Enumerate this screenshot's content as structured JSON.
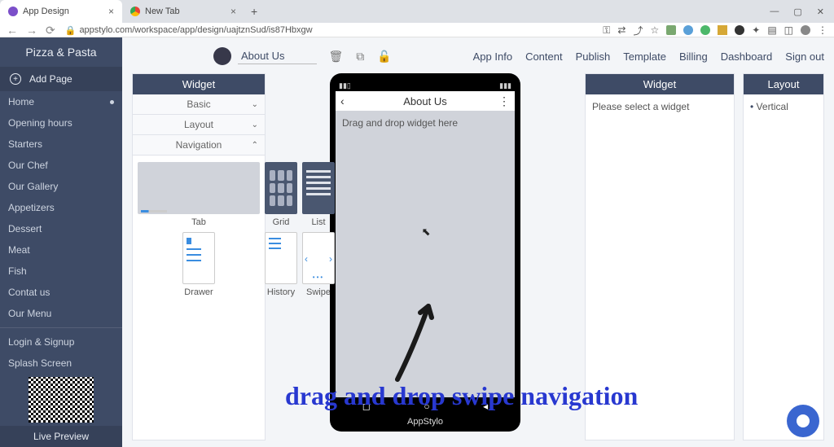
{
  "browser": {
    "tab1": "App Design",
    "tab2": "New Tab",
    "url": "appstylo.com/workspace/app/design/uajtznSud/is87Hbxgw"
  },
  "sidebar": {
    "brand": "Pizza & Pasta",
    "add_page": "Add Page",
    "items": [
      "Home",
      "Opening hours",
      "Starters",
      "Our Chef",
      "Our Gallery",
      "Appetizers",
      "Dessert",
      "Meat",
      "Fish",
      "Contat us",
      "Our Menu"
    ],
    "items2": [
      "Login & Signup",
      "Splash Screen"
    ],
    "live": "Live Preview"
  },
  "topbar": {
    "page_title": "About Us",
    "nav": [
      "App Info",
      "Content",
      "Publish",
      "Template",
      "Billing",
      "Dashboard",
      "Sign out"
    ]
  },
  "left_panel": {
    "header": "Widget",
    "sections": {
      "basic": "Basic",
      "layout": "Layout",
      "navigation": "Navigation"
    },
    "widgets": [
      "Tab",
      "Grid",
      "List",
      "Drawer",
      "History",
      "Swipe"
    ]
  },
  "phone": {
    "title": "About Us",
    "placeholder": "Drag and drop widget here",
    "brand": "AppStylo"
  },
  "right_panel": {
    "header": "Widget",
    "msg": "Please select a widget"
  },
  "layout_panel": {
    "header": "Layout",
    "item": "Vertical"
  },
  "caption": "drag and drop swipe navigation"
}
